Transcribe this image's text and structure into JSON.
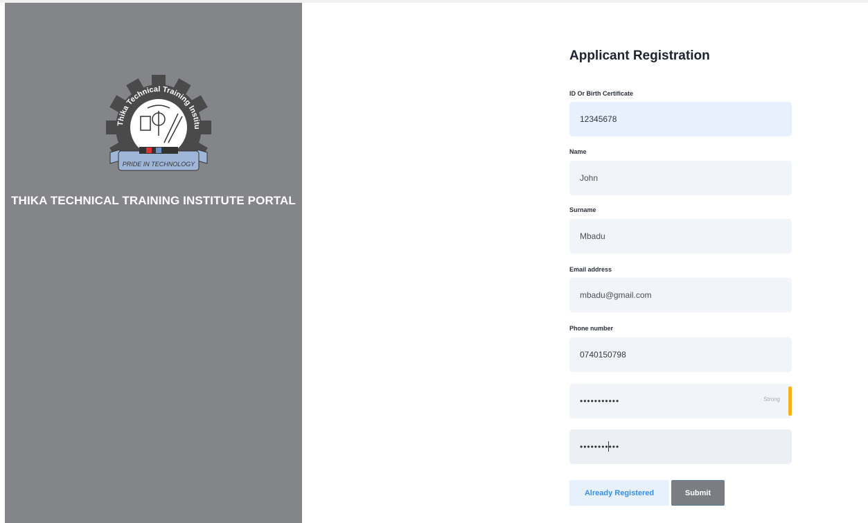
{
  "sidebar": {
    "portal_title": "THIKA TECHNICAL TRAINING INSTITUTE PORTAL",
    "logo": {
      "ring_text": "Thika Technical Training Institute",
      "motto": "PRIDE IN TECHNOLOGY"
    }
  },
  "form": {
    "title": "Applicant Registration",
    "fields": {
      "id_label": "ID Or Birth Certificate",
      "id_value": "12345678",
      "name_label": "Name",
      "name_value": "John",
      "surname_label": "Surname",
      "surname_value": "Mbadu",
      "email_label": "Email address",
      "email_value": "mbadu@gmail.com",
      "phone_label": "Phone number",
      "phone_value": "0740150798",
      "password_masked": "•••••••••••",
      "password_strength": "Strong",
      "confirm_masked": "•••••••••••"
    },
    "buttons": {
      "already_registered": "Already Registered",
      "submit": "Submit"
    }
  },
  "colors": {
    "sidebar": "#848589",
    "strength": "#f7b21b",
    "link": "#3b8ce8"
  }
}
